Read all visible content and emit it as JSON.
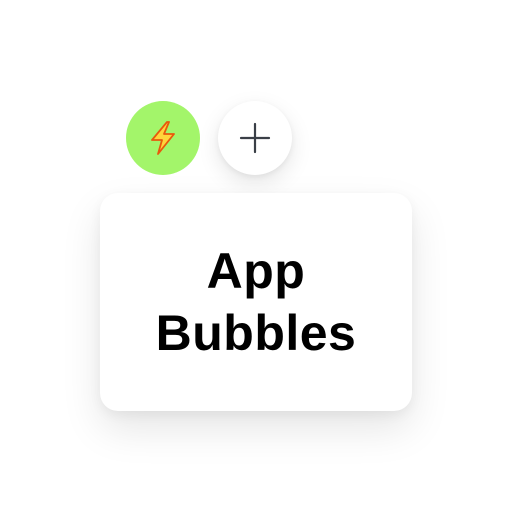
{
  "bubbles": [
    {
      "name": "lightning-bubble",
      "icon": "lightning-icon",
      "color": "#a3f56a",
      "active": true
    },
    {
      "name": "add-bubble",
      "icon": "plus-icon",
      "color": "#ffffff",
      "active": false
    }
  ],
  "popover": {
    "title_line1": "App",
    "title_line2": "Bubbles"
  },
  "colors": {
    "accent": "#a3f56a",
    "lightning_fill": "#ffd43b",
    "lightning_stroke": "#e8590c",
    "plus_stroke": "#3a3f47"
  }
}
